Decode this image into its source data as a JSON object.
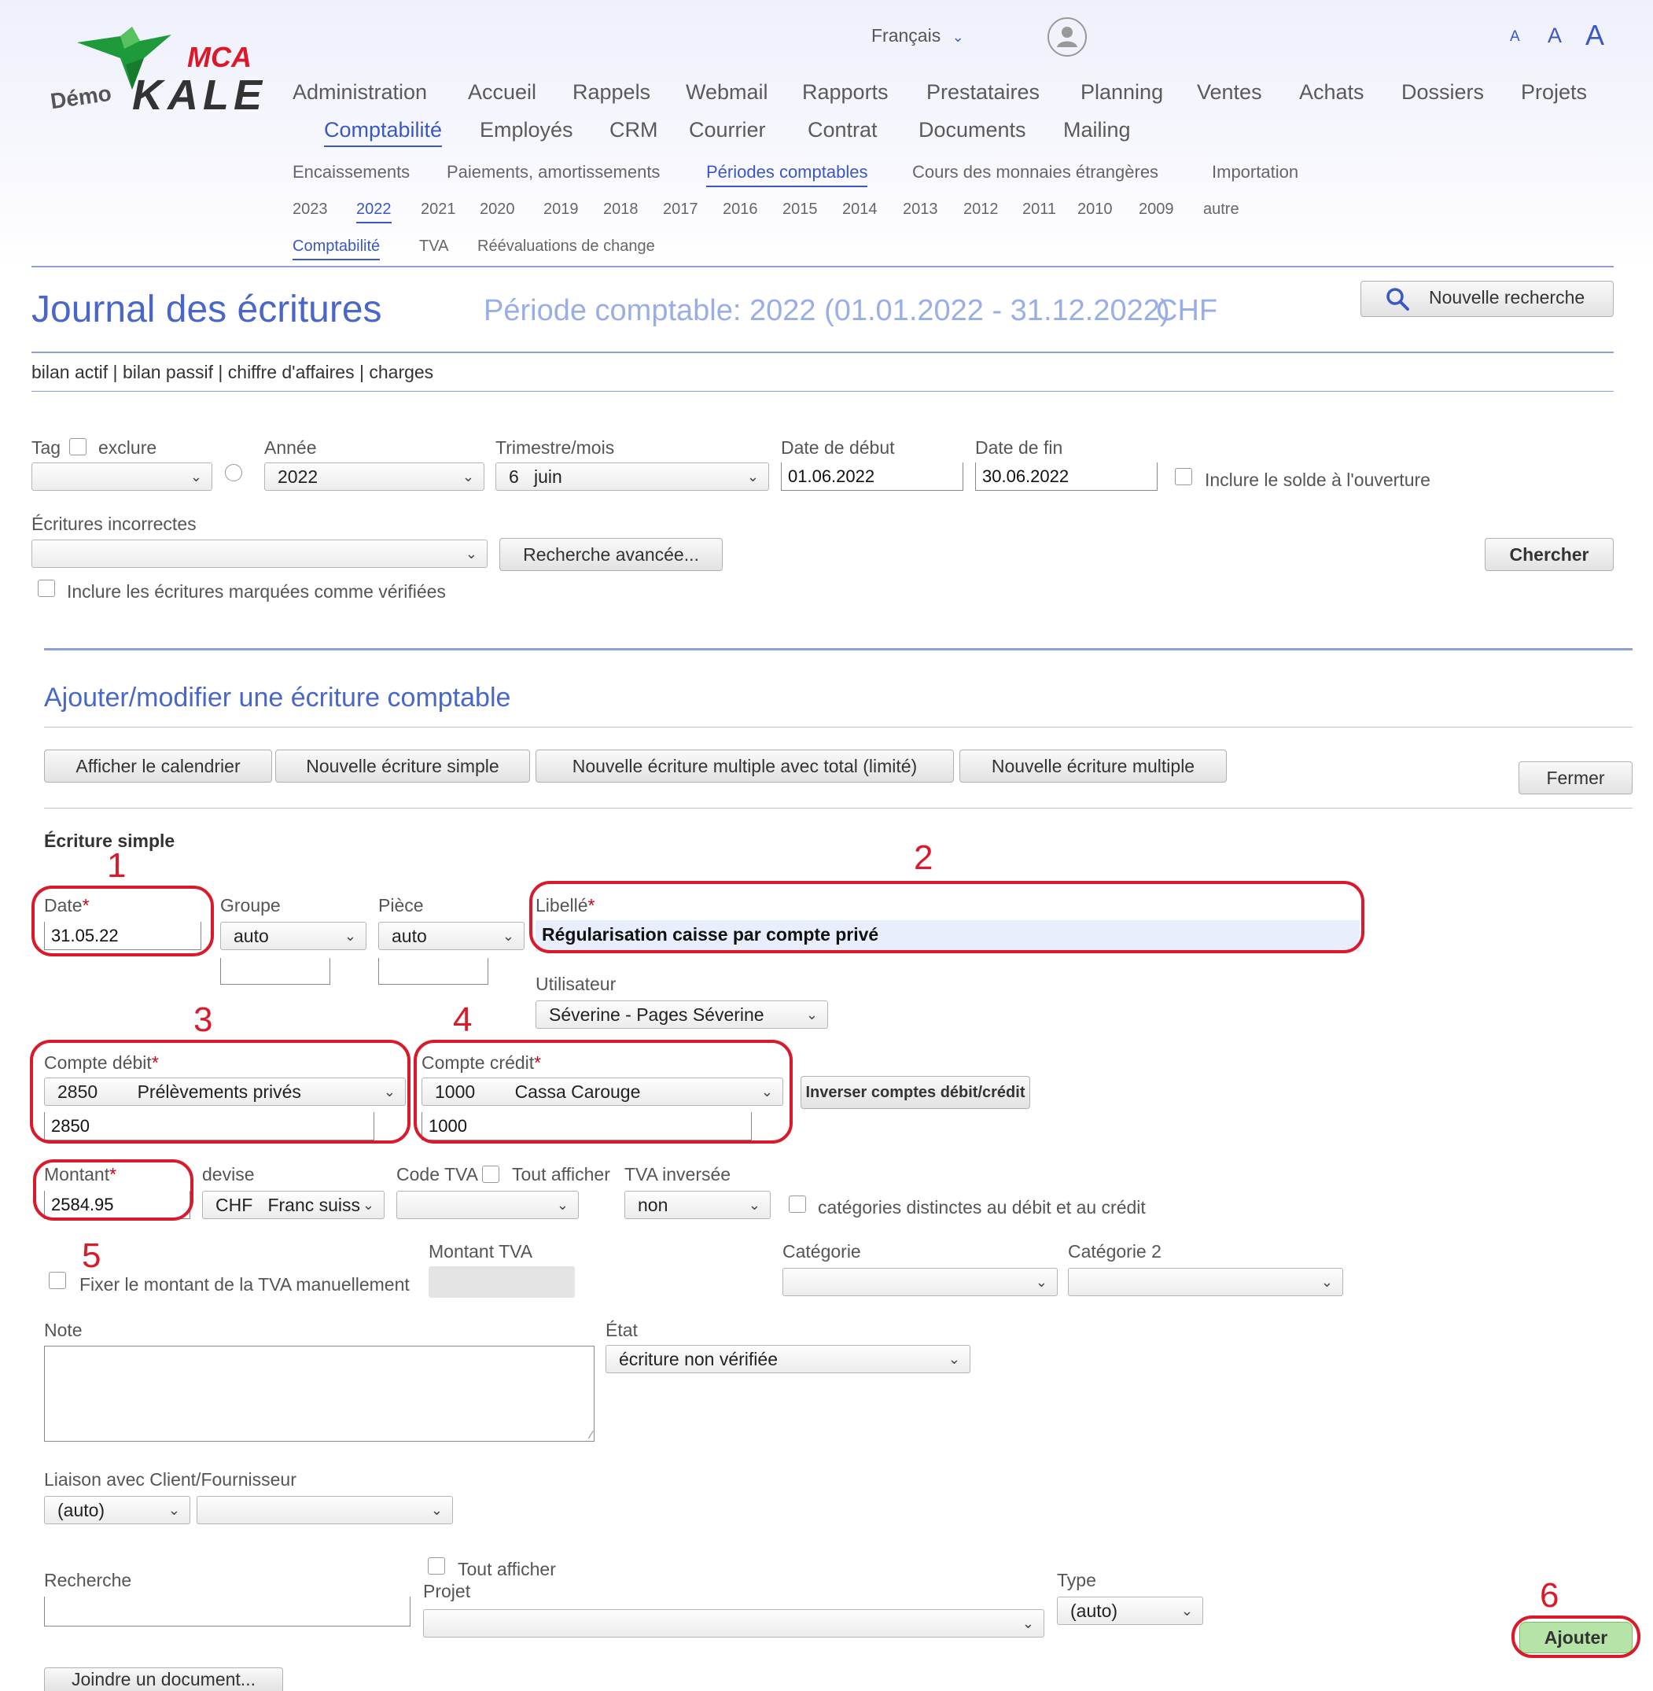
{
  "language": {
    "label": "Français"
  },
  "logo": {
    "brand": "MCA",
    "demo": "Démo",
    "name": "KALE"
  },
  "font_sizes": [
    "A",
    "A",
    "A"
  ],
  "nav": {
    "main_row1": [
      "Administration",
      "Accueil",
      "Rappels",
      "Webmail",
      "Rapports",
      "Prestataires",
      "Planning",
      "Ventes",
      "Achats",
      "Dossiers",
      "Projets"
    ],
    "main_row2": [
      "Comptabilité",
      "Employés",
      "CRM",
      "Courrier",
      "Contrat",
      "Documents",
      "Mailing"
    ],
    "sub": [
      "Encaissements",
      "Paiements, amortissements",
      "Périodes comptables",
      "Cours des monnaies étrangères",
      "Importation"
    ],
    "years": [
      "2023",
      "2022",
      "2021",
      "2020",
      "2019",
      "2018",
      "2017",
      "2016",
      "2015",
      "2014",
      "2013",
      "2012",
      "2011",
      "2010",
      "2009",
      "autre"
    ],
    "tabs": [
      "Comptabilité",
      "TVA",
      "Réévaluations de change"
    ]
  },
  "page": {
    "title": "Journal des écritures",
    "period": "Période comptable: 2022 (01.01.2022 - 31.12.2022)",
    "currency": "CHF",
    "new_search": "Nouvelle recherche",
    "links": [
      "bilan actif",
      "bilan passif",
      "chiffre d'affaires",
      "charges"
    ]
  },
  "filters": {
    "tag_label": "Tag",
    "exclude_label": "exclure",
    "tag_value": "",
    "year_label": "Année",
    "year_value": "2022",
    "period_label": "Trimestre/mois",
    "period_value": "6   juin",
    "start_label": "Date de début",
    "start_value": "01.06.2022",
    "end_label": "Date de fin",
    "end_value": "30.06.2022",
    "opening_label": "Inclure le solde à l'ouverture",
    "incorrect_label": "Écritures incorrectes",
    "incorrect_value": "",
    "advanced": "Recherche avancée...",
    "search": "Chercher",
    "verified_label": "Inclure les écritures marquées comme vérifiées"
  },
  "editor": {
    "title": "Ajouter/modifier une écriture comptable",
    "buttons": [
      "Afficher le calendrier",
      "Nouvelle écriture simple",
      "Nouvelle écriture multiple avec total (limité)",
      "Nouvelle écriture multiple"
    ],
    "close": "Fermer",
    "section": "Écriture simple",
    "date_label": "Date",
    "date_value": "31.05.22",
    "group_label": "Groupe",
    "group_value": "auto",
    "piece_label": "Pièce",
    "piece_value": "auto",
    "libelle_label": "Libellé",
    "libelle_value": "Régularisation caisse par compte privé",
    "user_label": "Utilisateur",
    "user_value": "Séverine - Pages Séverine",
    "debit_label": "Compte débit",
    "debit_code": "2850",
    "debit_name": "Prélèvements privés",
    "debit_input": "2850",
    "credit_label": "Compte crédit",
    "credit_code": "1000",
    "credit_name": "Cassa Carouge",
    "credit_input": "1000",
    "swap": "Inverser comptes débit/crédit",
    "amount_label": "Montant",
    "amount_value": "2584.95",
    "currency_label": "devise",
    "currency_value": "CHF   Franc suiss",
    "vat_code_label": "Code TVA",
    "show_all_label": "Tout afficher",
    "vat_reverse_label": "TVA inversée",
    "vat_reverse_value": "non",
    "separate_cat_label": "catégories distinctes au débit et au crédit",
    "manual_vat_label": "Fixer le montant de la TVA manuellement",
    "vat_amount_label": "Montant TVA",
    "category_label": "Catégorie",
    "category2_label": "Catégorie 2",
    "note_label": "Note",
    "state_label": "État",
    "state_value": "écriture non vérifiée",
    "link_label": "Liaison avec Client/Fournisseur",
    "link_value": "(auto)",
    "search_label": "Recherche",
    "show_all2_label": "Tout afficher",
    "project_label": "Projet",
    "type_label": "Type",
    "type_value": "(auto)",
    "add": "Ajouter",
    "attach": "Joindre un document..."
  },
  "annotations": [
    "1",
    "2",
    "3",
    "4",
    "5",
    "6"
  ],
  "colors": {
    "accent": "#3b57c2",
    "annotation": "#d91a2a",
    "add_button": "#b6e3a8"
  }
}
